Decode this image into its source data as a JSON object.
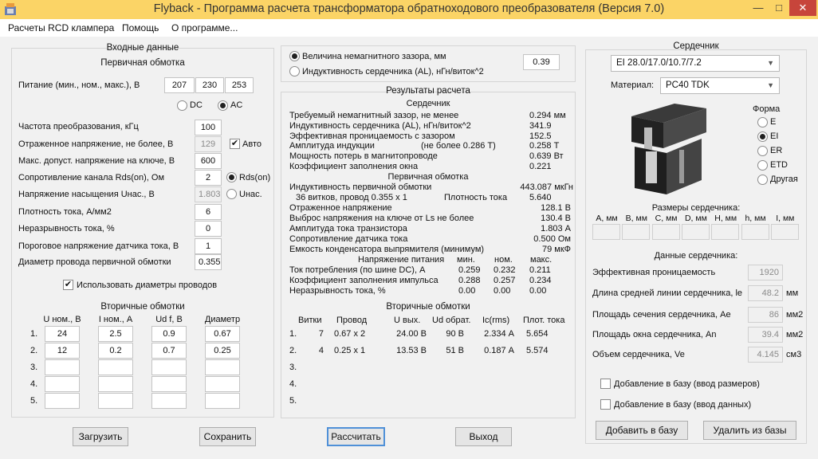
{
  "window": {
    "title": "Flyback - Программа расчета трансформатора обратноходового преобразователя (Версия 7.0)",
    "min": "—",
    "max": "□",
    "close": "✕"
  },
  "menu": [
    "Расчеты RCD клампера",
    "Помощь",
    "О программе..."
  ],
  "left": {
    "title": "Входные данные",
    "primary_title": "Первичная обмотка",
    "supply": {
      "label": "Питание (мин., ном., макс.), В",
      "values": [
        "207",
        "230",
        "253"
      ]
    },
    "dc": "DC",
    "ac": "AC",
    "rows": [
      {
        "label": "Частота преобразования, кГц",
        "value": "100"
      },
      {
        "label": "Отраженное напряжение, не более, В",
        "value": "129"
      },
      {
        "label": "Макс. допуст. напряжение на ключе, В",
        "value": "600"
      },
      {
        "label": "Сопротивление канала Rds(on), Ом",
        "value": "2"
      },
      {
        "label": "Напряжение насыщения Uнас., В",
        "value": "1.803"
      },
      {
        "label": "Плотность тока, А/мм2",
        "value": "6"
      },
      {
        "label": "Неразрывность тока, %",
        "value": "0"
      },
      {
        "label": "Пороговое напряжение датчика тока, В",
        "value": "1"
      },
      {
        "label": "Диаметр провода первичной обмотки",
        "value": "0.355"
      }
    ],
    "auto": "Авто",
    "rdson": "Rds(on)",
    "usat": "Uнас.",
    "use_wire": "Использовать диаметры проводов",
    "secondary_title": "Вторичные обмотки",
    "sec_headers": [
      "U ном., В",
      "I ном., А",
      "Ud f, В",
      "Диаметр"
    ],
    "sec_rows": [
      {
        "n": "1.",
        "vals": [
          "24",
          "2.5",
          "0.9",
          "0.67"
        ]
      },
      {
        "n": "2.",
        "vals": [
          "12",
          "0.2",
          "0.7",
          "0.25"
        ]
      },
      {
        "n": "3.",
        "vals": [
          "",
          "",
          "",
          ""
        ]
      },
      {
        "n": "4.",
        "vals": [
          "",
          "",
          "",
          ""
        ]
      },
      {
        "n": "5.",
        "vals": [
          "",
          "",
          "",
          ""
        ]
      }
    ]
  },
  "gap": {
    "opt1": "Величина немагнитного зазора, мм",
    "opt2": "Индуктивность сердечника (AL), нГн/виток^2",
    "value": "0.39"
  },
  "results": {
    "title": "Результаты расчета",
    "core_title": "Сердечник",
    "core_rows": [
      {
        "label": "Требуемый немагнитный зазор, не менее",
        "value": "0.294 мм"
      },
      {
        "label": "Индуктивность сердечника (AL), нГн/виток^2",
        "value": "341.9"
      },
      {
        "label": "Эффективная проницаемость с зазором",
        "value": "152.5"
      },
      {
        "label": "Амплитуда индукции",
        "note": "(не более 0.286 Т)",
        "value": "0.258 Т"
      },
      {
        "label": "Мощность потерь в магнитопроводе",
        "value": "0.639 Вт"
      },
      {
        "label": "Коэффициент заполнения окна",
        "value": "0.221"
      }
    ],
    "primary_title": "Первичная обмотка",
    "ind_label": "Индуктивность первичной обмотки",
    "ind_value": "443.087 мкГн",
    "turns": "36 витков, провод 0.355 x 1",
    "density_label": "Плотность тока",
    "density_value": "5.640",
    "prim_rows": [
      {
        "label": "Отраженное напряжение",
        "value": "128.1 В"
      },
      {
        "label": "Выброс напряжения на ключе от Ls не более",
        "value": "130.4 В"
      },
      {
        "label": "Амплитуда тока транзистора",
        "value": "1.803 А"
      },
      {
        "label": "Сопротивление датчика тока",
        "value": "0.500 Ом"
      },
      {
        "label": "Емкость конденсатора выпрямителя (минимум)",
        "value": "79 мкФ"
      }
    ],
    "supply_hdr": {
      "label": "Напряжение питания",
      "cols": [
        "мин.",
        "ном.",
        "макс."
      ]
    },
    "supply_rows": [
      {
        "label": "Ток потребления (по шине DC), А",
        "vals": [
          "0.259",
          "0.232",
          "0.211"
        ]
      },
      {
        "label": "Коэффициент заполнения импульса",
        "vals": [
          "0.288",
          "0.257",
          "0.234"
        ]
      },
      {
        "label": "Неразрывность тока, %",
        "vals": [
          "0.00",
          "0.00",
          "0.00"
        ]
      }
    ],
    "sec_title": "Вторичные обмотки",
    "sec_headers": [
      "Витки",
      "Провод",
      "U вых.",
      "Ud обрат.",
      "Ic(rms)",
      "Плот. тока"
    ],
    "sec_rows": [
      {
        "n": "1.",
        "vals": [
          "7",
          "0.67 x 2",
          "24.00 В",
          "90 В",
          "2.334 А",
          "5.654"
        ]
      },
      {
        "n": "2.",
        "vals": [
          "4",
          "0.25 x 1",
          "13.53 В",
          "51 В",
          "0.187 А",
          "5.574"
        ]
      },
      {
        "n": "3.",
        "vals": [
          "",
          "",
          "",
          "",
          "",
          ""
        ]
      },
      {
        "n": "4.",
        "vals": [
          "",
          "",
          "",
          "",
          "",
          ""
        ]
      },
      {
        "n": "5.",
        "vals": [
          "",
          "",
          "",
          "",
          "",
          ""
        ]
      }
    ]
  },
  "core": {
    "title": "Сердечник",
    "selected": "EI 28.0/17.0/10.7/7.2",
    "material_label": "Материал:",
    "material": "PC40 TDK",
    "shape_title": "Форма",
    "shapes": [
      "E",
      "EI",
      "ER",
      "ETD",
      "Другая"
    ],
    "sizes_title": "Размеры сердечника:",
    "size_headers": [
      "A, мм",
      "B, мм",
      "C, мм",
      "D, мм",
      "H, мм",
      "h, мм",
      "I, мм"
    ],
    "data_title": "Данные сердечника:",
    "data_rows": [
      {
        "label": "Эффективная проницаемость",
        "value": "1920",
        "unit": ""
      },
      {
        "label": "Длина средней линии сердечника, le",
        "value": "48.2",
        "unit": "мм"
      },
      {
        "label": "Площадь сечения сердечника, Ae",
        "value": "86",
        "unit": "мм2"
      },
      {
        "label": "Площадь окна сердечника, An",
        "value": "39.4",
        "unit": "мм2"
      },
      {
        "label": "Объем сердечника, Ve",
        "value": "4.145",
        "unit": "см3"
      }
    ],
    "add_sizes": "Добавление в базу (ввод размеров)",
    "add_data": "Добавление в базу (ввод данных)",
    "add_btn": "Добавить в базу",
    "del_btn": "Удалить из базы"
  },
  "buttons": {
    "load": "Загрузить",
    "save": "Сохранить",
    "calc": "Рассчитать",
    "exit": "Выход"
  },
  "colors": {
    "titlebar": "#fbd466",
    "close": "#c7453b",
    "selected_button": "#4f90d8"
  }
}
